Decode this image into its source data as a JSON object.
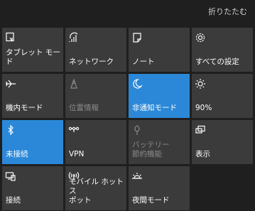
{
  "header": {
    "collapse_label": "折りたたむ"
  },
  "accent_color": "#2b88d8",
  "tiles": [
    {
      "label": "タブレット モード",
      "icon": "tablet-mode-icon",
      "state": "off"
    },
    {
      "label": "ネットワーク",
      "icon": "network-icon",
      "state": "off"
    },
    {
      "label": "ノート",
      "icon": "note-icon",
      "state": "off"
    },
    {
      "label": "すべての設定",
      "icon": "gear-icon",
      "state": "off"
    },
    {
      "label": "機内モード",
      "icon": "airplane-icon",
      "state": "off"
    },
    {
      "label": "位置情報",
      "icon": "location-icon",
      "state": "disabled"
    },
    {
      "label": "非通知モード",
      "icon": "moon-icon",
      "state": "on"
    },
    {
      "label": "90%",
      "icon": "brightness-icon",
      "state": "off"
    },
    {
      "label": "未接続",
      "icon": "bluetooth-icon",
      "state": "on"
    },
    {
      "label": "VPN",
      "icon": "vpn-icon",
      "state": "off"
    },
    {
      "label": "バッテリー\n節約機能",
      "icon": "battery-saver-icon",
      "state": "disabled"
    },
    {
      "label": "表示",
      "icon": "project-icon",
      "state": "off"
    },
    {
      "label": "接続",
      "icon": "connect-icon",
      "state": "off"
    },
    {
      "label": "モバイル ホットス\nポット",
      "icon": "hotspot-icon",
      "state": "off"
    },
    {
      "label": "夜間モード",
      "icon": "night-light-icon",
      "state": "off"
    }
  ]
}
